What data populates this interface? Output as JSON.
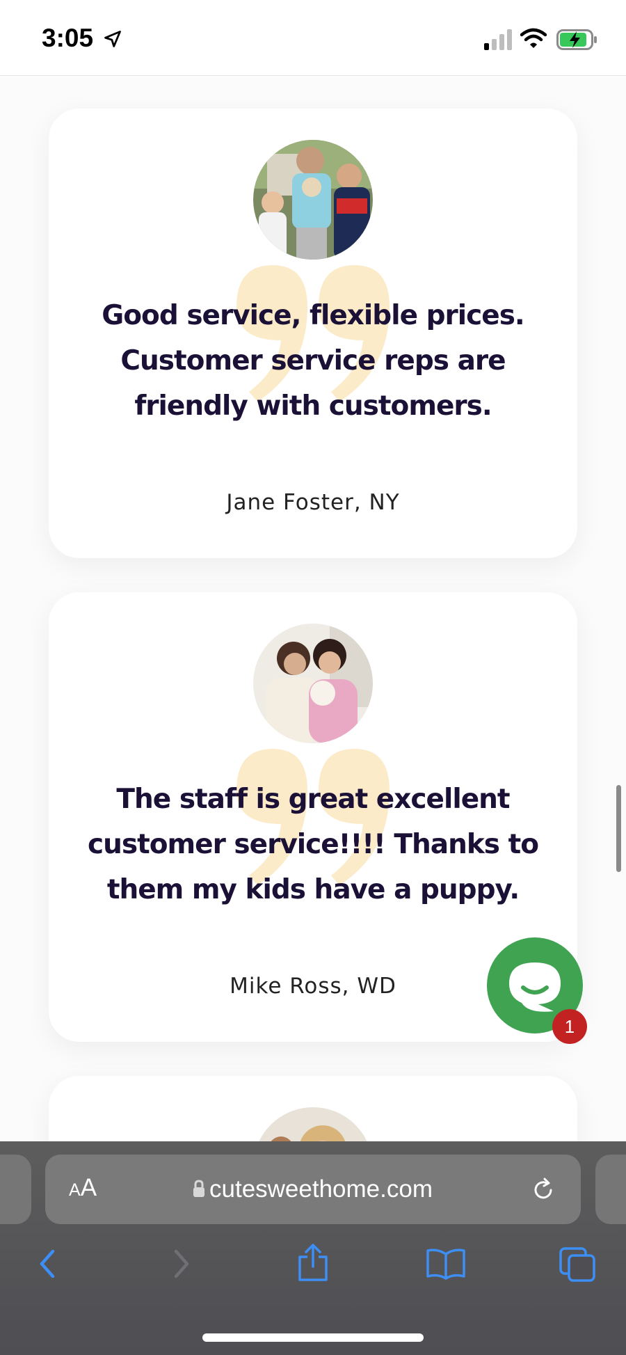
{
  "status_bar": {
    "time": "3:05",
    "icons": [
      "location-arrow-icon",
      "cellular-signal-icon",
      "wifi-icon",
      "battery-charging-icon"
    ]
  },
  "testimonials": [
    {
      "quote": "Good service, flexible prices. Customer service reps are friendly with customers.",
      "author": "Jane Foster, NY"
    },
    {
      "quote": "The staff is great excellent customer service!!!! Thanks to them my kids have a puppy.",
      "author": "Mike Ross, WD"
    }
  ],
  "chat_widget": {
    "badge_count": "1",
    "icon": "chat-bubble-icon"
  },
  "safari": {
    "text_size_button": {
      "small": "A",
      "large": "A"
    },
    "url": "cutesweethome.com",
    "toolbar_icons": [
      "back-icon",
      "forward-icon",
      "share-icon",
      "bookmarks-icon",
      "tabs-icon"
    ]
  },
  "colors": {
    "quote_text": "#1b1036",
    "quote_mark": "#fbe6bc",
    "chat_green": "#3fa352",
    "badge_red": "#c32222",
    "safari_blue": "#3d8ff5"
  }
}
